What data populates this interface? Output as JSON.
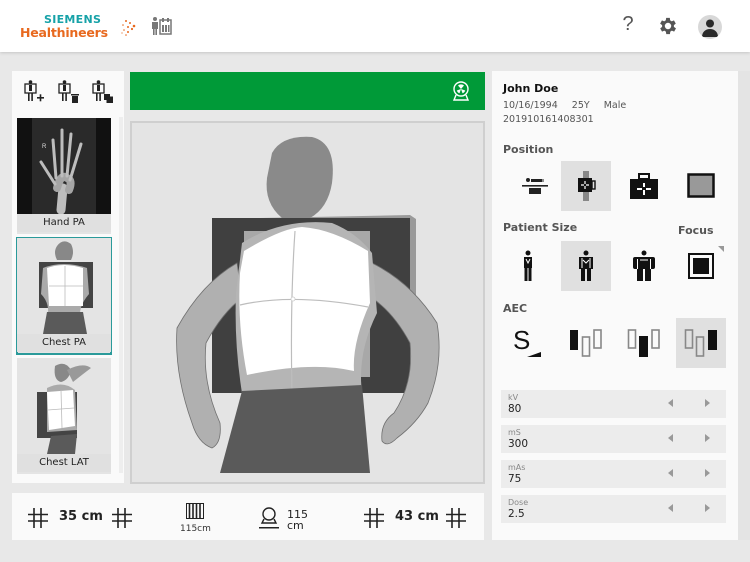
{
  "header": {
    "brand_top": "SIEMENS",
    "brand_bottom": "Healthineers",
    "exam_icon": "patient-exam-icon",
    "help_label": "?",
    "settings_icon": "gear-icon",
    "user_icon": "user-avatar-icon"
  },
  "sidebar": {
    "tools": [
      {
        "icon": "add-exam-icon"
      },
      {
        "icon": "delete-exam-icon"
      },
      {
        "icon": "copy-exam-icon"
      }
    ],
    "thumbnails": [
      {
        "label": "Hand PA",
        "selected": false
      },
      {
        "label": "Chest PA",
        "selected": true
      },
      {
        "label": "Chest LAT",
        "selected": false
      }
    ],
    "hand_marker": "R"
  },
  "status": {
    "color": "#009a38",
    "icon": "radiation-tube-icon"
  },
  "bottom_bar": {
    "width_value": "35 cm",
    "grid_label": "115cm",
    "sid_value": "115",
    "sid_unit": "cm",
    "height_value": "43 cm"
  },
  "patient": {
    "name": "John Doe",
    "dob": "10/16/1994",
    "age": "25Y",
    "sex": "Male",
    "id": "201910161408301"
  },
  "sections": {
    "position": "Position",
    "patient_size": "Patient Size",
    "focus": "Focus",
    "aec": "AEC"
  },
  "position_options": [
    {
      "icon": "table-position-icon",
      "selected": false
    },
    {
      "icon": "wall-stand-position-icon",
      "selected": true
    },
    {
      "icon": "portable-detector-icon",
      "selected": false
    },
    {
      "icon": "free-detector-icon",
      "selected": false
    }
  ],
  "size_options": [
    {
      "icon": "patient-small-icon",
      "selected": false
    },
    {
      "icon": "patient-medium-icon",
      "selected": true
    },
    {
      "icon": "patient-large-icon",
      "selected": false
    }
  ],
  "focus_option": {
    "icon": "large-focus-icon"
  },
  "aec_options": [
    {
      "icon": "aec-sensitivity-icon",
      "label": "S",
      "selected": false
    },
    {
      "icon": "aec-left-chamber-icon",
      "selected": false
    },
    {
      "icon": "aec-center-chamber-icon",
      "selected": false
    },
    {
      "icon": "aec-right-chamber-icon",
      "selected": true
    }
  ],
  "parameters": [
    {
      "label": "kV",
      "value": "80"
    },
    {
      "label": "mS",
      "value": "300"
    },
    {
      "label": "mAs",
      "value": "75"
    },
    {
      "label": "Dose",
      "value": "2.5"
    }
  ]
}
